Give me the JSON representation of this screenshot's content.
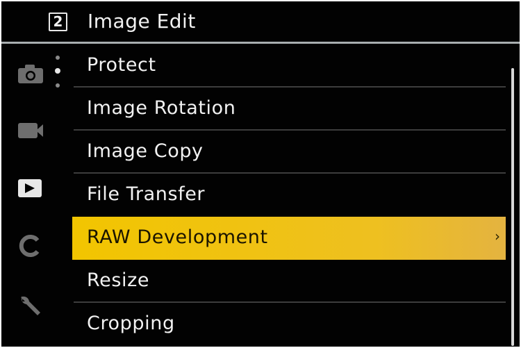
{
  "header": {
    "page_number": "2",
    "title": "Image Edit"
  },
  "sidebar": {
    "icons": [
      "camera-icon",
      "video-icon",
      "playback-icon",
      "custom-mode-icon",
      "wrench-icon"
    ],
    "active": "playback-icon"
  },
  "menu": {
    "items": [
      {
        "label": "Protect"
      },
      {
        "label": "Image Rotation"
      },
      {
        "label": "Image Copy"
      },
      {
        "label": "File Transfer"
      },
      {
        "label": "RAW Development",
        "selected": true,
        "chevron": "›"
      },
      {
        "label": "Resize"
      },
      {
        "label": "Cropping"
      }
    ]
  },
  "colors": {
    "background": "#020202",
    "highlight": "#f2c500",
    "text": "#f2f2f2",
    "divider": "#a9aeb0"
  }
}
